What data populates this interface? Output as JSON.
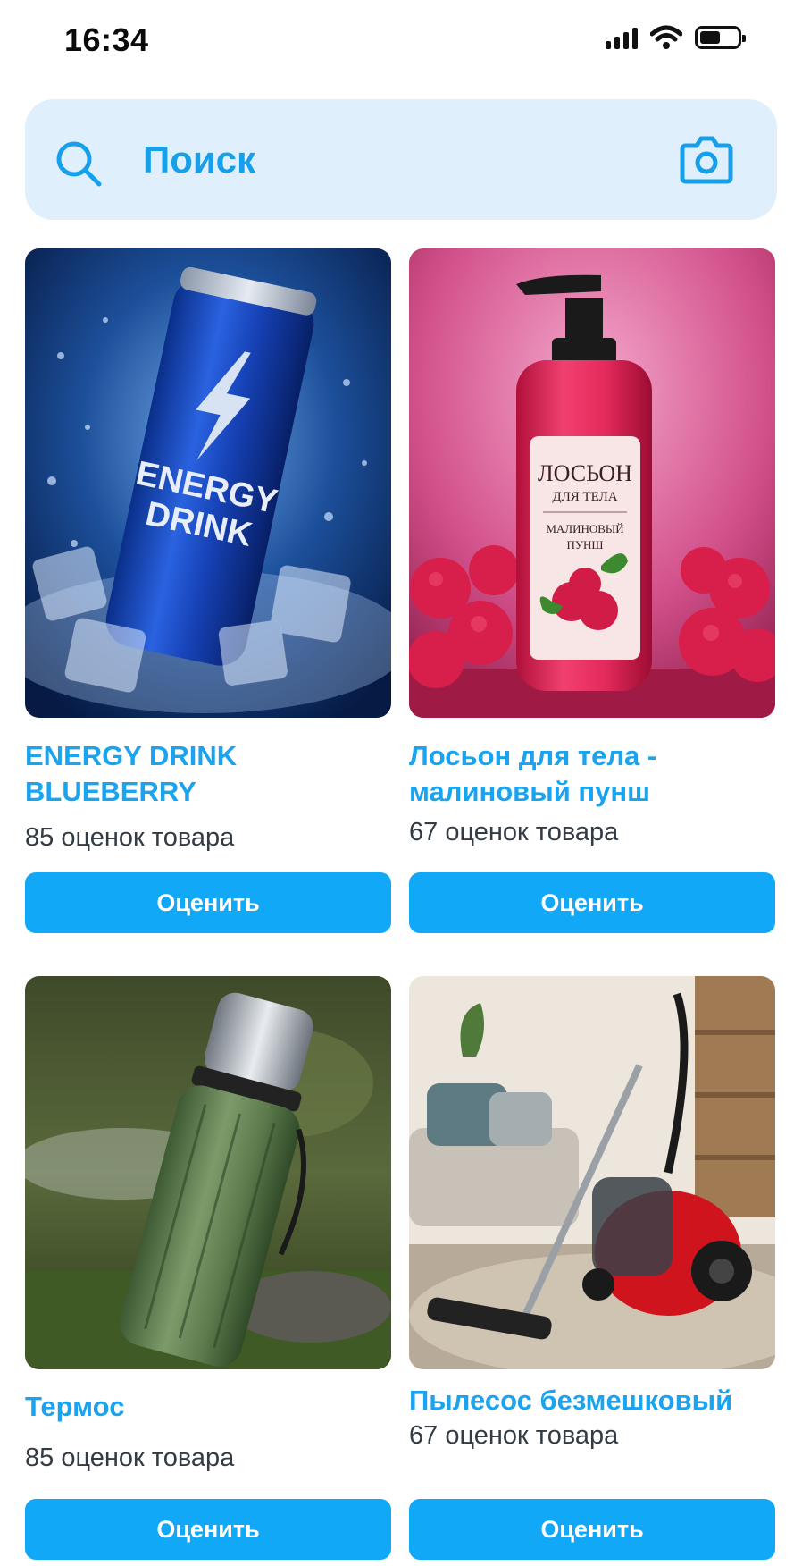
{
  "status_bar": {
    "time": "16:34",
    "icons": [
      "signal-icon",
      "wifi-icon",
      "battery-icon"
    ],
    "battery_level": 0.55
  },
  "search": {
    "placeholder": "Поиск",
    "icons": [
      "search-icon",
      "camera-icon"
    ],
    "accent_color": "#17a0e9",
    "background": "#dff0fc"
  },
  "products": [
    {
      "title": "ENERGY DRINK BLUEBERRY",
      "rating_text": "85 оценок товара",
      "button_label": "Оценить",
      "image_text": [
        "ENERGY",
        "DRINK"
      ]
    },
    {
      "title": "Лосьон для тела - малиновый пунш",
      "rating_text": "67 оценок товара",
      "button_label": "Оценить",
      "image_text": [
        "ЛОСЬОН",
        "ДЛЯ ТЕЛА",
        "МАЛИНОВЫЙ",
        "ПУНШ"
      ]
    },
    {
      "title": "Термос",
      "rating_text": "85 оценок товара",
      "button_label": "Оценить",
      "image_text": []
    },
    {
      "title": "Пылесос безмешковый",
      "rating_text": "67 оценок товара",
      "button_label": "Оценить",
      "image_text": []
    }
  ],
  "colors": {
    "title": "#1aa3ef",
    "button": "#10a8f7",
    "button_text": "#ffffff"
  }
}
